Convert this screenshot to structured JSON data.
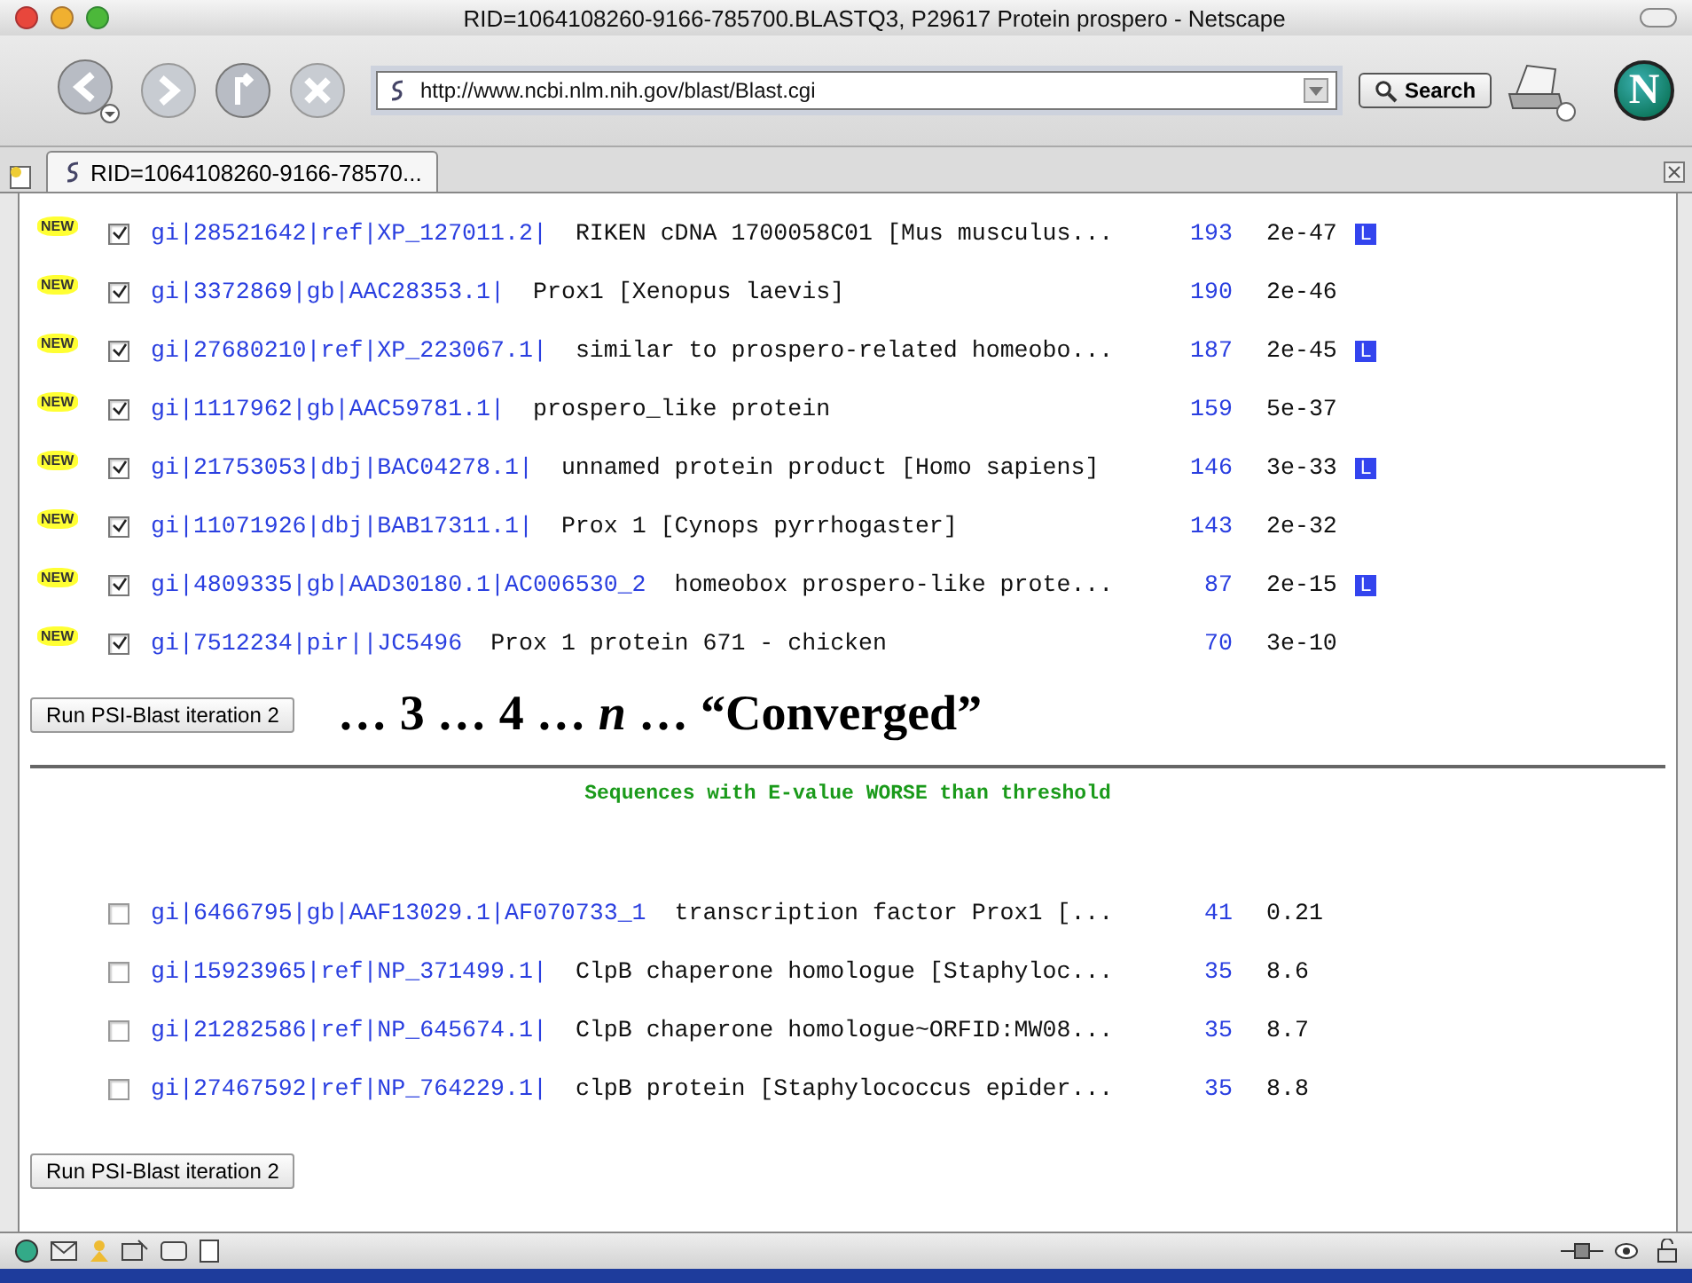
{
  "window": {
    "title": "RID=1064108260-9166-785700.BLASTQ3, P29617 Protein prospero - Netscape"
  },
  "toolbar": {
    "url": "http://www.ncbi.nlm.nih.gov/blast/Blast.cgi",
    "search_button": "Search",
    "logo": "N"
  },
  "tabs": [
    {
      "label": "RID=1064108260-9166-78570...",
      "selected": true
    }
  ],
  "hits": [
    {
      "new_badge": "NEW",
      "checked": true,
      "link": "gi|28521642|ref|XP_127011.2|",
      "description": "RIKEN cDNA 1700058C01 [Mus musculus...",
      "score": "193",
      "evalue": "2e-47",
      "link_badge": "L"
    },
    {
      "new_badge": "NEW",
      "checked": true,
      "link": "gi|3372869|gb|AAC28353.1|",
      "description": "Prox1 [Xenopus laevis]",
      "score": "190",
      "evalue": "2e-46"
    },
    {
      "new_badge": "NEW",
      "checked": true,
      "link": "gi|27680210|ref|XP_223067.1|",
      "description": "similar to prospero-related homeobo...",
      "score": "187",
      "evalue": "2e-45",
      "link_badge": "L"
    },
    {
      "new_badge": "NEW",
      "checked": true,
      "link": "gi|1117962|gb|AAC59781.1|",
      "description": "prospero_like protein",
      "score": "159",
      "evalue": "5e-37"
    },
    {
      "new_badge": "NEW",
      "checked": true,
      "link": "gi|21753053|dbj|BAC04278.1|",
      "description": "unnamed protein product [Homo sapiens]",
      "score": "146",
      "evalue": "3e-33",
      "link_badge": "L"
    },
    {
      "new_badge": "NEW",
      "checked": true,
      "link": "gi|11071926|dbj|BAB17311.1|",
      "description": "Prox 1 [Cynops pyrrhogaster]",
      "score": "143",
      "evalue": "2e-32"
    },
    {
      "new_badge": "NEW",
      "checked": true,
      "link": "gi|4809335|gb|AAD30180.1|AC006530_2",
      "description": "homeobox prospero-like prote...",
      "score": "87",
      "evalue": "2e-15",
      "link_badge": "L"
    },
    {
      "new_badge": "NEW",
      "checked": true,
      "link": "gi|7512234|pir||JC5496",
      "description": "Prox 1 protein 671 - chicken",
      "score": "70",
      "evalue": "3e-10"
    }
  ],
  "run_button_1": "Run PSI-Blast iteration 2",
  "annotation": "… 3 … 4 … *n* … “Converged”",
  "worse_heading": "Sequences with E-value WORSE than threshold",
  "worse_hits": [
    {
      "checked": false,
      "link": "gi|6466795|gb|AAF13029.1|AF070733_1",
      "description": "transcription factor Prox1 [...",
      "score": "41",
      "evalue": "0.21"
    },
    {
      "checked": false,
      "link": "gi|15923965|ref|NP_371499.1|",
      "description": "ClpB chaperone homologue [Staphyloc...",
      "score": "35",
      "evalue": "8.6"
    },
    {
      "checked": false,
      "link": "gi|21282586|ref|NP_645674.1|",
      "description": "ClpB chaperone homologue~ORFID:MW08...",
      "score": "35",
      "evalue": "8.7"
    },
    {
      "checked": false,
      "link": "gi|27467592|ref|NP_764229.1|",
      "description": "clpB protein [Staphylococcus epider...",
      "score": "35",
      "evalue": "8.8"
    }
  ],
  "run_button_2": "Run PSI-Blast iteration 2"
}
